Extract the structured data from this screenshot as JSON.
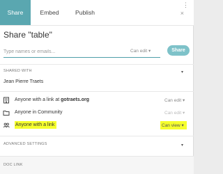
{
  "tabs": [
    {
      "label": "Share",
      "active": true
    },
    {
      "label": "Embed",
      "active": false
    },
    {
      "label": "Publish",
      "active": false
    }
  ],
  "header": {
    "title": "Share \"table\""
  },
  "invite": {
    "placeholder": "Type names or emails...",
    "permission": "Can edit ▾",
    "share_button": "Share"
  },
  "shared_with": {
    "label": "SHARED WITH",
    "person": "Jean Pierre Traets"
  },
  "access_rows": [
    {
      "icon": "building-icon",
      "prefix": "Anyone with a link at ",
      "bold": "gotraets.org",
      "permission": "Can edit ▾",
      "disabled": false,
      "highlighted": false
    },
    {
      "icon": "folder-icon",
      "prefix": "Anyone in Community",
      "bold": "",
      "permission": "Can edit ▾",
      "disabled": true,
      "highlighted": false
    },
    {
      "icon": "people-icon",
      "prefix": "Anyone with a link",
      "bold": "",
      "permission": "Can view ▾",
      "disabled": false,
      "highlighted": true
    }
  ],
  "advanced": {
    "label": "ADVANCED SETTINGS"
  },
  "doc_link": {
    "label": "DOC LINK"
  },
  "colors": {
    "accent": "#5aa7b0",
    "highlight": "#f6ff2e"
  }
}
